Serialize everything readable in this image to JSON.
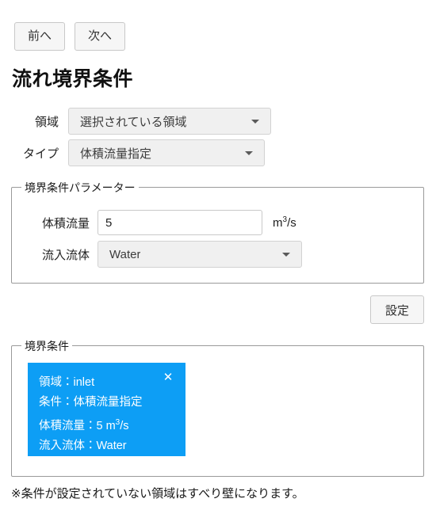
{
  "nav": {
    "prev_label": "前へ",
    "next_label": "次へ"
  },
  "page": {
    "title": "流れ境界条件"
  },
  "selectors": {
    "region": {
      "label": "領域",
      "value": "選択されている領域",
      "arrow_icon": "chevron-down-icon"
    },
    "type": {
      "label": "タイプ",
      "value": "体積流量指定",
      "arrow_icon": "chevron-down-icon"
    }
  },
  "params_fieldset": {
    "legend": "境界条件パラメーター",
    "flowrate": {
      "label": "体積流量",
      "value": "5",
      "unit_prefix": "m",
      "unit_sup": "3",
      "unit_suffix": "/s"
    },
    "fluid": {
      "label": "流入流体",
      "value": "Water",
      "arrow_icon": "chevron-down-icon"
    }
  },
  "actions": {
    "set_label": "設定"
  },
  "bc_fieldset": {
    "legend": "境界条件",
    "cards": [
      {
        "line1": "領域：inlet",
        "line2": "条件：体積流量指定",
        "line3_prefix": "体積流量：5 m",
        "line3_sup": "3",
        "line3_suffix": "/s",
        "line4": "流入流体：Water",
        "close_icon": "close-icon",
        "close_glyph": "✕",
        "bg_color": "#0d9ef5"
      }
    ]
  },
  "footer": {
    "note": "※条件が設定されていない領域はすべり壁になります。"
  }
}
